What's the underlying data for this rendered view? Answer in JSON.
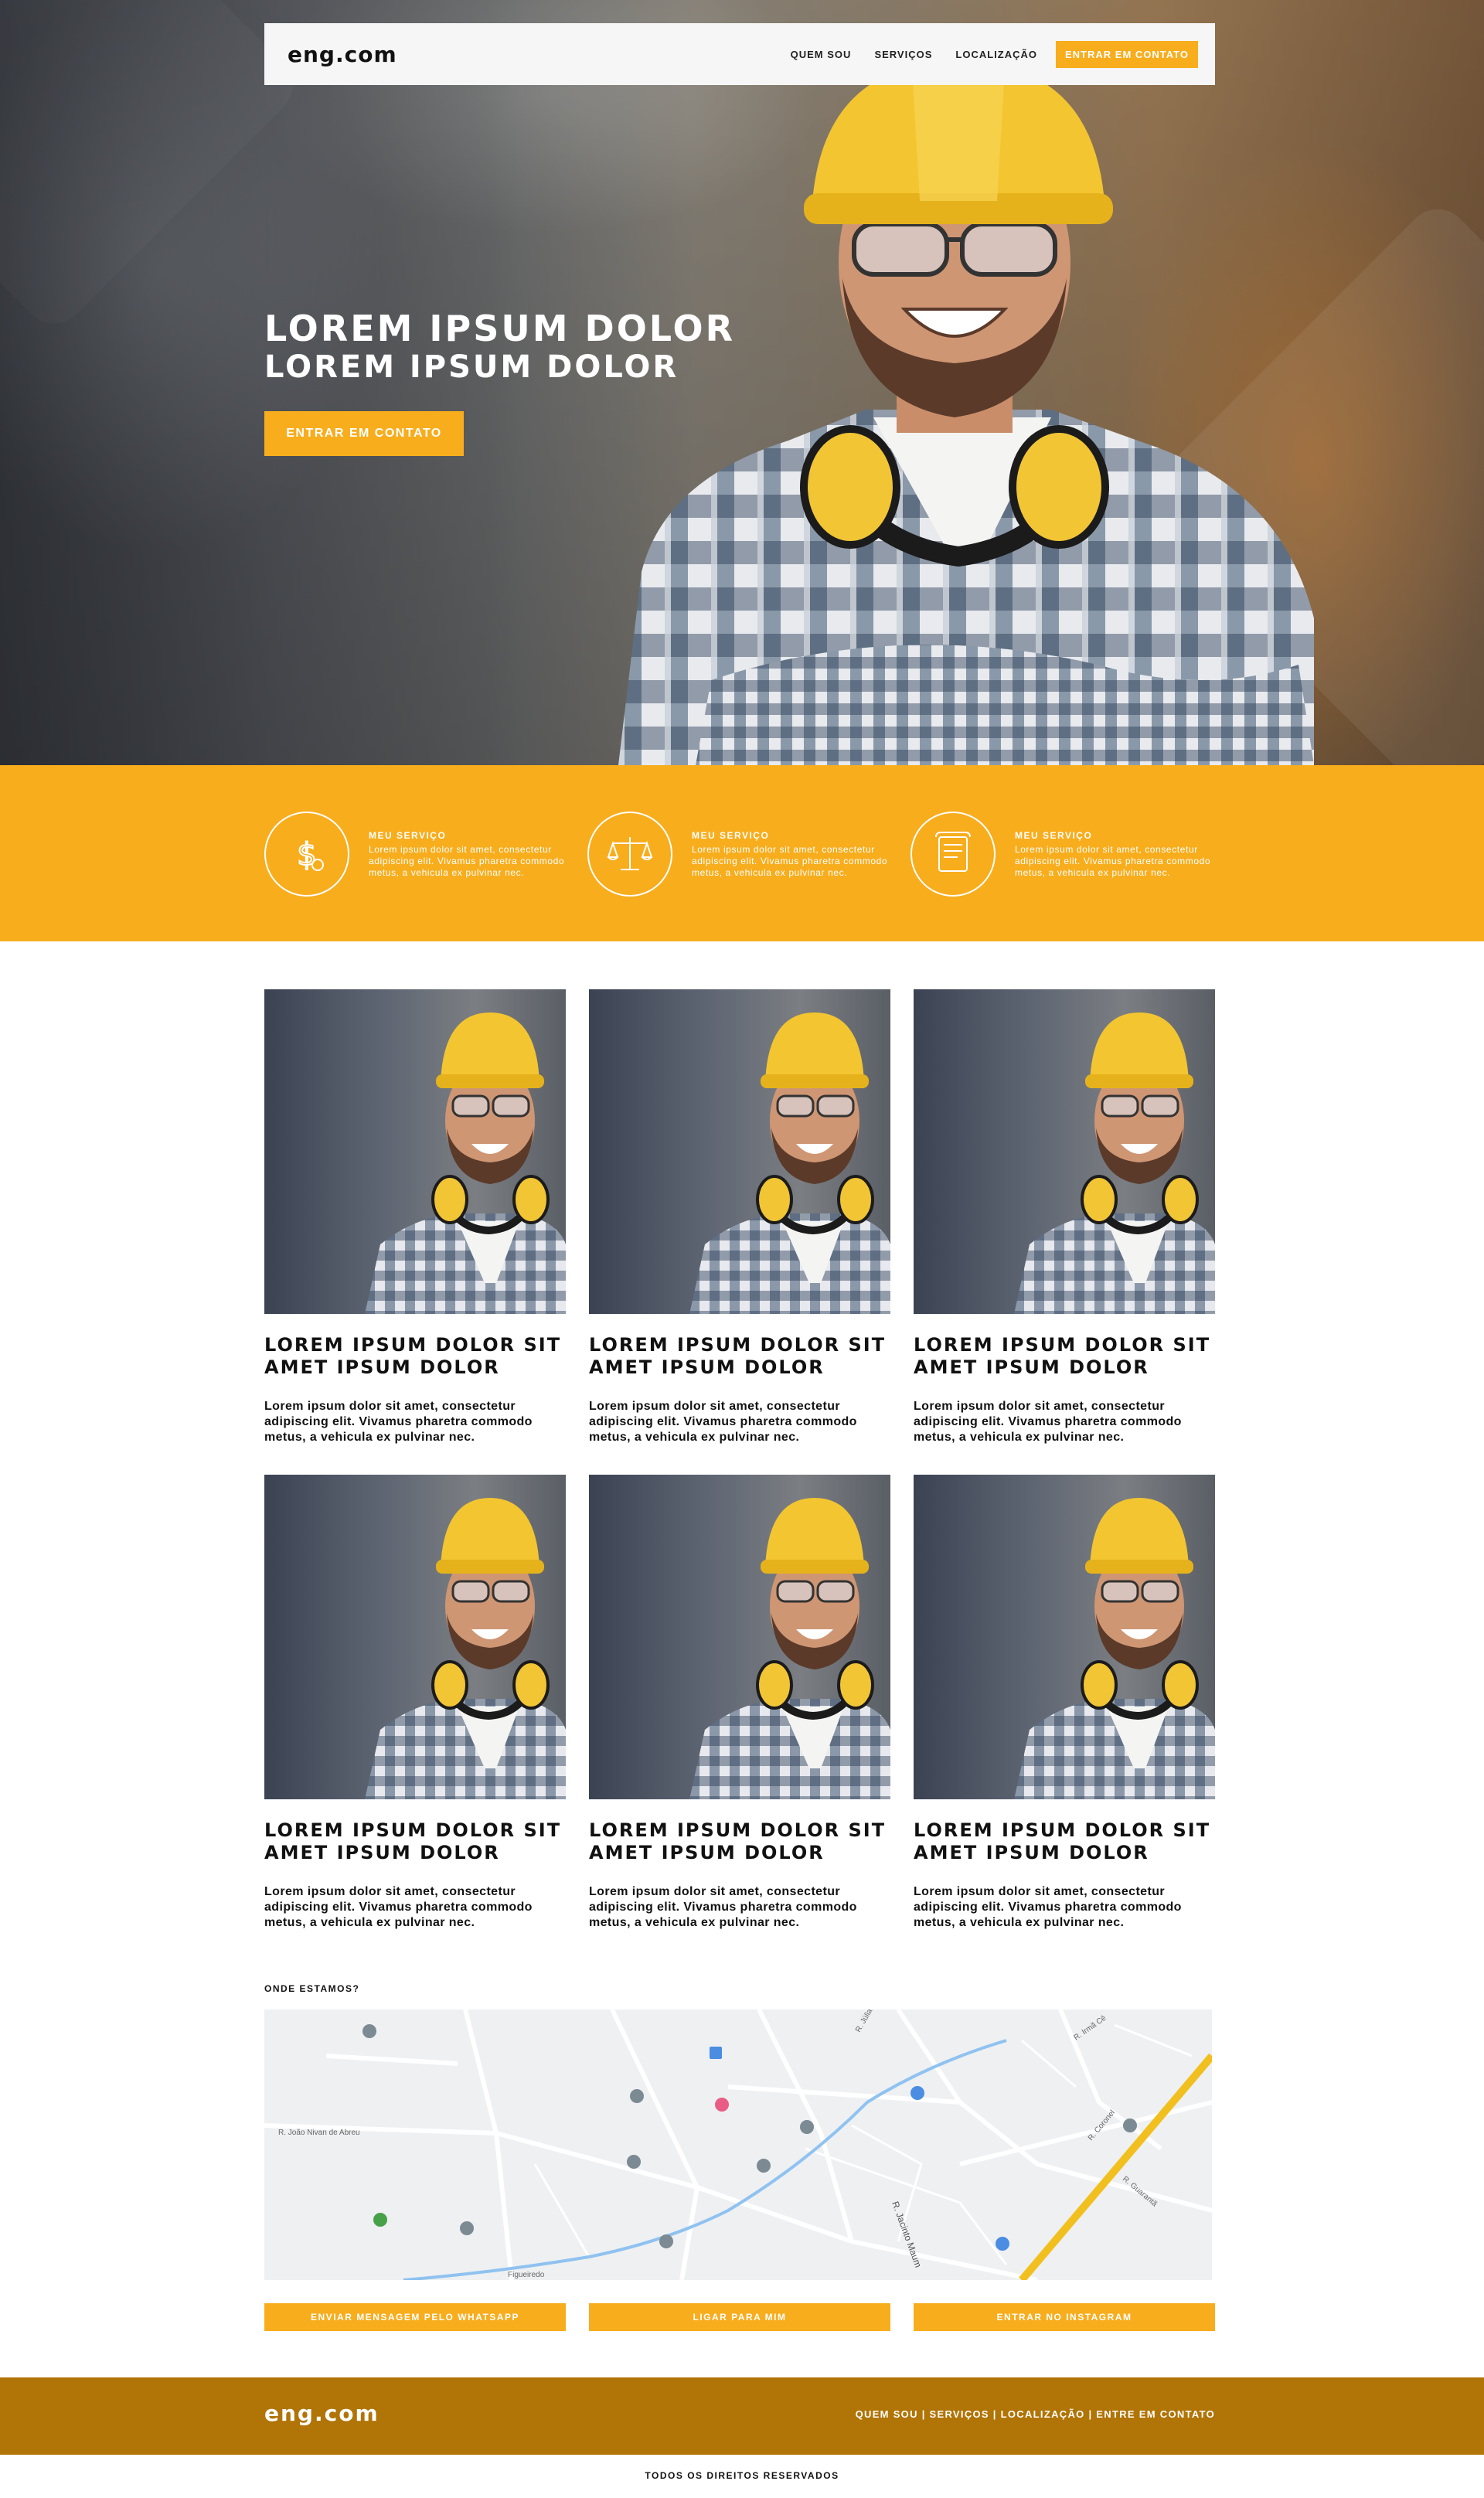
{
  "nav": {
    "logo": "eng.com",
    "links": [
      "QUEM SOU",
      "SERVIÇOS",
      "LOCALIZAÇÃO"
    ],
    "cta": "ENTRAR EM CONTATO"
  },
  "hero": {
    "title": "LOREM IPSUM DOLOR",
    "subtitle": "LOREM IPSUM DOLOR",
    "button": "ENTRAR EM CONTATO"
  },
  "services": [
    {
      "icon": "money-icon",
      "title": "MEU SERVIÇO",
      "text": "Lorem ipsum dolor sit amet, consectetur adipiscing elit. Vivamus pharetra commodo metus, a vehicula ex pulvinar nec."
    },
    {
      "icon": "scales-icon",
      "title": "MEU SERVIÇO",
      "text": "Lorem ipsum dolor sit amet, consectetur adipiscing elit. Vivamus pharetra commodo metus, a vehicula ex pulvinar nec."
    },
    {
      "icon": "scroll-icon",
      "title": "MEU SERVIÇO",
      "text": "Lorem ipsum dolor sit amet, consectetur adipiscing elit. Vivamus pharetra commodo metus, a vehicula ex pulvinar nec."
    }
  ],
  "cards": [
    {
      "title": "LOREM IPSUM DOLOR SIT AMET IPSUM DOLOR",
      "text": "Lorem ipsum dolor sit amet, consectetur adipiscing elit. Vivamus pharetra commodo metus, a vehicula ex pulvinar nec."
    },
    {
      "title": "LOREM IPSUM DOLOR SIT AMET IPSUM DOLOR",
      "text": "Lorem ipsum dolor sit amet, consectetur adipiscing elit. Vivamus pharetra commodo metus, a vehicula ex pulvinar nec."
    },
    {
      "title": "LOREM IPSUM DOLOR SIT AMET IPSUM DOLOR",
      "text": "Lorem ipsum dolor sit amet, consectetur adipiscing elit. Vivamus pharetra commodo metus, a vehicula ex pulvinar nec."
    },
    {
      "title": "LOREM IPSUM DOLOR SIT AMET IPSUM DOLOR",
      "text": "Lorem ipsum dolor sit amet, consectetur adipiscing elit. Vivamus pharetra commodo metus, a vehicula ex pulvinar nec."
    },
    {
      "title": "LOREM IPSUM DOLOR SIT AMET IPSUM DOLOR",
      "text": "Lorem ipsum dolor sit amet, consectetur adipiscing elit. Vivamus pharetra commodo metus, a vehicula ex pulvinar nec."
    },
    {
      "title": "LOREM IPSUM DOLOR SIT AMET IPSUM DOLOR",
      "text": "Lorem ipsum dolor sit amet, consectetur adipiscing elit. Vivamus pharetra commodo metus, a vehicula ex pulvinar nec."
    }
  ],
  "map": {
    "label": "ONDE ESTAMOS?",
    "streets": [
      "R. Júlia Bucih",
      "R. Irmã Cê",
      "R. João Nivan de Abreu",
      "R. Jacinto Maum",
      "R. Coronel",
      "R. Guarantã",
      "Figueiredo"
    ]
  },
  "ctas": [
    "ENVIAR MENSAGEM PELO WHATSAPP",
    "LIGAR PARA MIM",
    "ENTRAR NO INSTAGRAM"
  ],
  "footer": {
    "logo": "eng.com",
    "links": "QUEM SOU | SERVIÇOS | LOCALIZAÇÃO | ENTRE EM CONTATO",
    "copyright": "TODOS OS DIREITOS RESERVADOS"
  },
  "colors": {
    "accent": "#f8ad1d",
    "footer": "#b17406"
  }
}
